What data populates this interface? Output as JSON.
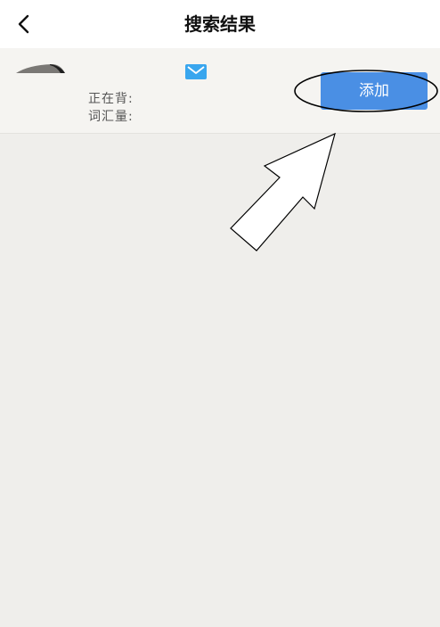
{
  "header": {
    "back_icon": "chevron-left-icon",
    "title": "搜索结果"
  },
  "result": {
    "avatar_icon": "avatar-image",
    "mail_icon": "mail-icon",
    "studying_label": "正在背:",
    "vocab_label": "词汇量:",
    "add_button_label": "添加"
  },
  "colors": {
    "accent": "#4a8fe4",
    "mail": "#39a6ee",
    "background": "#efeeeb"
  }
}
